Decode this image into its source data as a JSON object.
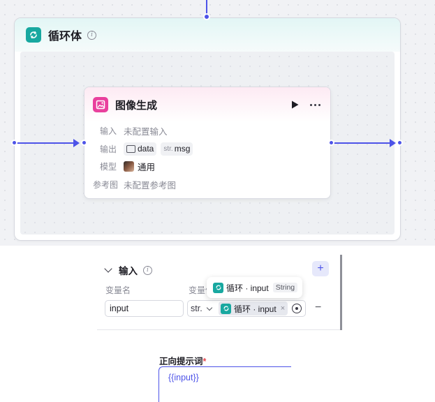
{
  "loop_node": {
    "title": "循环体",
    "info_icon": "info-icon",
    "icon": "loop-icon"
  },
  "image_node": {
    "title": "图像生成",
    "icon": "image-generation-icon",
    "run_icon": "play-icon",
    "more_icon": "more-icon",
    "rows": {
      "input_label": "输入",
      "input_value": "未配置输入",
      "output_label": "输出",
      "output_data": "data",
      "output_msg_prefix": "str.",
      "output_msg": "msg",
      "model_label": "模型",
      "model_value": "通用",
      "reference_label": "参考图",
      "reference_value": "未配置参考图"
    }
  },
  "input_panel": {
    "title": "输入",
    "add_label": "+",
    "col_name": "变量名",
    "col_value": "变量值",
    "row": {
      "name": "input",
      "type": "str.",
      "ref_label": "循环 · input",
      "close": "×",
      "remove": "−"
    }
  },
  "tooltip": {
    "ref_label": "循环 · input",
    "type": "String"
  },
  "prompt_panel": {
    "label": "正向提示词",
    "required_mark": "*",
    "value": "{{input}}"
  },
  "colors": {
    "accent": "#4d53e8",
    "loop_teal": "#18a8a0",
    "image_pink": "#e9409d"
  }
}
